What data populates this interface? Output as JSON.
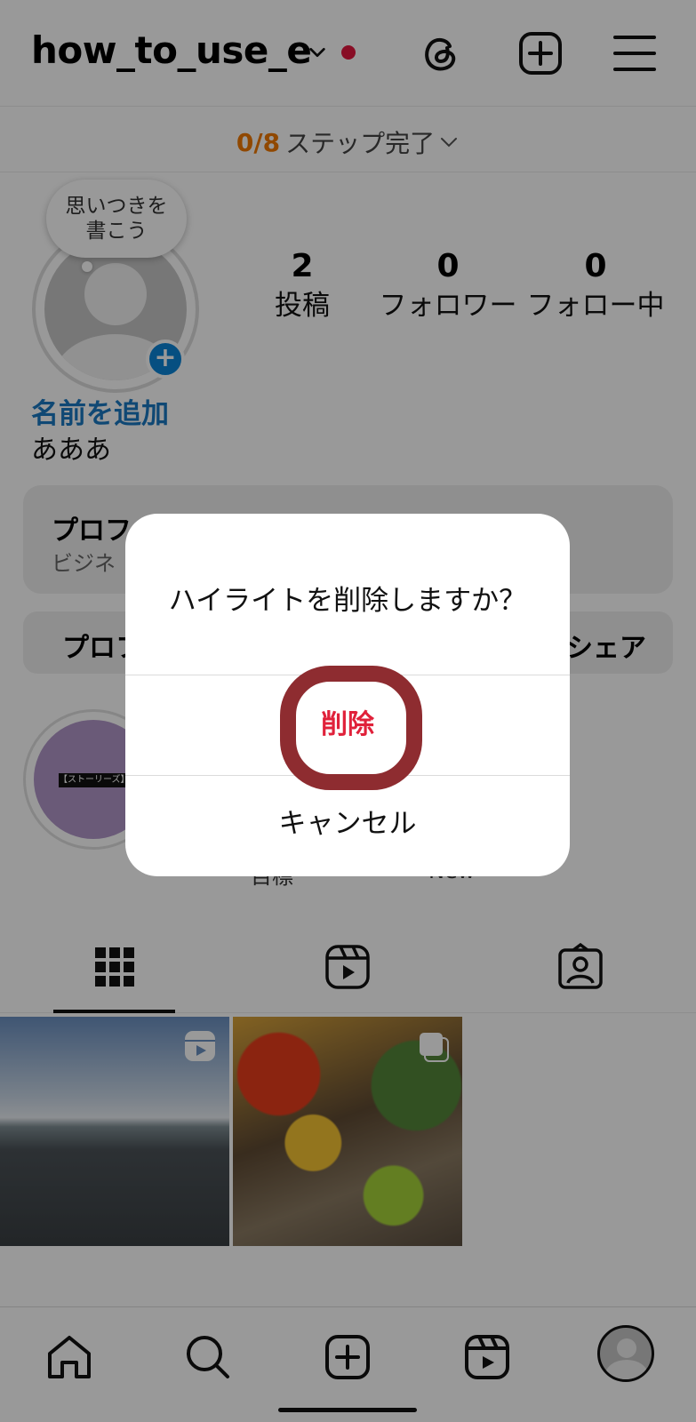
{
  "header": {
    "username": "how_to_use_e",
    "icons": [
      "chevron-down-icon",
      "threads-icon",
      "add-post-icon",
      "menu-icon"
    ],
    "notification_dot_color": "#e3173e"
  },
  "step_bar": {
    "count": "0/8",
    "label": "ステップ完了"
  },
  "profile": {
    "thought_bubble": "思いつきを\n書こう",
    "stats": [
      {
        "num": "2",
        "label": "投稿"
      },
      {
        "num": "0",
        "label": "フォロワー"
      },
      {
        "num": "0",
        "label": "フォロー中"
      }
    ],
    "add_name": "名前を追加",
    "bio": "あああ",
    "accent_color": "#1a78c2"
  },
  "pro_card": {
    "title": "プロフ",
    "subtitle": "ビジネ"
  },
  "buttons": {
    "left": "プロフ",
    "right": "シェア"
  },
  "highlights": {
    "story_tag": "【ストーリーズ】",
    "labels": [
      "目標",
      "New"
    ]
  },
  "tabs": [
    "grid-icon",
    "reels-icon",
    "tagged-icon"
  ],
  "posts": [
    {
      "kind": "reel",
      "icon": "reels-icon"
    },
    {
      "kind": "carousel",
      "icon": "carousel-icon"
    }
  ],
  "bottom_nav": [
    "home-icon",
    "search-icon",
    "create-icon",
    "reels-icon",
    "profile-avatar"
  ],
  "dialog": {
    "title": "ハイライトを削除しますか？",
    "delete_label": "削除",
    "cancel_label": "キャンセル",
    "delete_color": "#e0213a",
    "annotation_color": "#8e2c30"
  }
}
